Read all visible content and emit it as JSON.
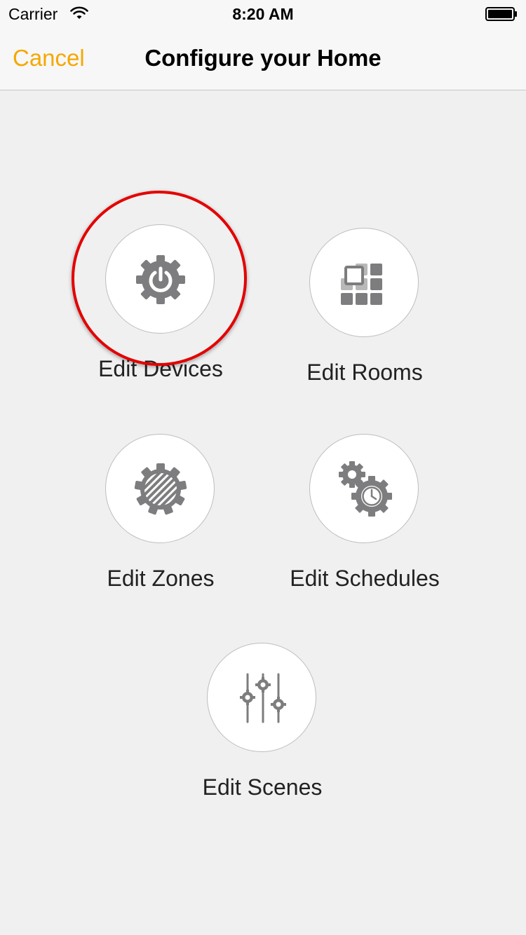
{
  "status_bar": {
    "carrier": "Carrier",
    "time": "8:20 AM",
    "wifi_icon": "wifi-icon",
    "battery_icon": "battery-icon"
  },
  "nav": {
    "cancel_label": "Cancel",
    "title": "Configure your Home"
  },
  "colors": {
    "accent": "#f5a800",
    "icon_gray": "#7d7d7f",
    "highlight_ring": "#e30000",
    "background": "#f0f0f0"
  },
  "tiles": [
    {
      "label": "Edit Devices",
      "icon": "power-gear-icon",
      "highlighted": true
    },
    {
      "label": "Edit Rooms",
      "icon": "rooms-grid-icon",
      "highlighted": false
    },
    {
      "label": "Edit Zones",
      "icon": "striped-gear-icon",
      "highlighted": false
    },
    {
      "label": "Edit Schedules",
      "icon": "gears-clock-icon",
      "highlighted": false
    },
    {
      "label": "Edit Scenes",
      "icon": "sliders-gears-icon",
      "highlighted": false
    }
  ]
}
